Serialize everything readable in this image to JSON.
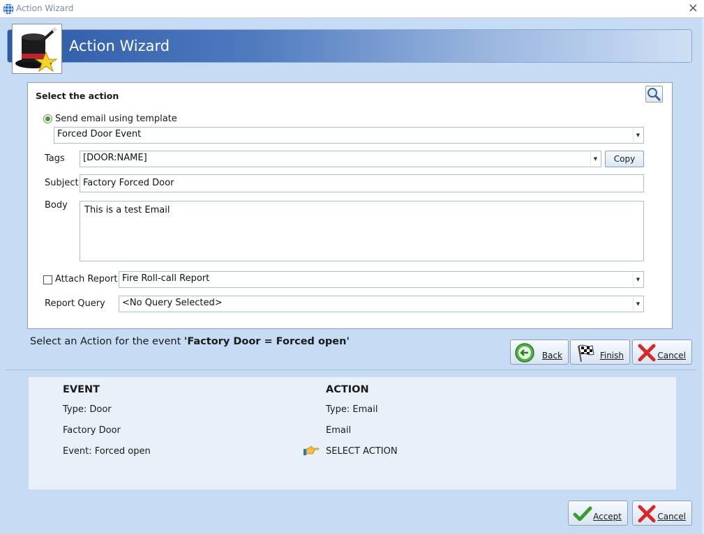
{
  "window": {
    "title": "Action Wizard",
    "close_glyph": "×"
  },
  "banner": {
    "title": "Action Wizard",
    "logo_icon": "magic-hat-star-icon"
  },
  "action": {
    "heading": "Select the action",
    "send_email_label": "Send email using template",
    "template_value": "Forced Door Event",
    "tags_label": "Tags",
    "tags_value": "[DOOR:NAME]",
    "copy_label": "Copy",
    "subject_label": "Subject",
    "subject_value": "Factory Forced Door",
    "body_label": "Body",
    "body_value": "This is a test Email",
    "attach_label": "Attach Report",
    "attach_value": "Fire Roll-call Report",
    "query_label": "Report Query",
    "query_value": "<No Query Selected>"
  },
  "prompt": {
    "prefix": "Select an Action for the event ",
    "event": "'Factory Door = Forced open'"
  },
  "nav": {
    "back": "Back",
    "finish": "Finish",
    "cancel": "Cancel"
  },
  "summary": {
    "event_head": "EVENT",
    "event_type": "Type: Door",
    "event_name": "Factory Door",
    "event_event": "Event: Forced open",
    "action_head": "ACTION",
    "action_type": "Type: Email",
    "action_name": "Email",
    "action_select": "SELECT ACTION"
  },
  "footer": {
    "accept": "Accept",
    "cancel": "Cancel"
  },
  "colors": {
    "banner_start": "#2d5aa6",
    "accent_green": "#3b9b2f",
    "cancel_red": "#d62828"
  }
}
